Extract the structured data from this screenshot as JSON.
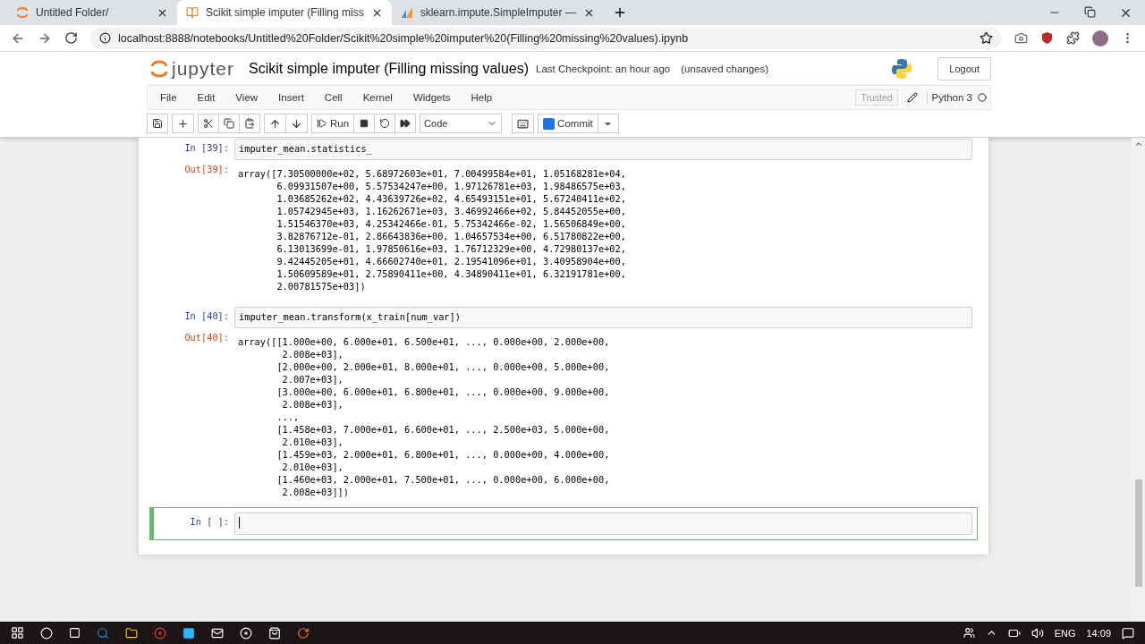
{
  "browser": {
    "tabs": [
      {
        "title": "Untitled Folder/",
        "selected": false
      },
      {
        "title": "Scikit simple imputer (Filling miss",
        "selected": true
      },
      {
        "title": "sklearn.impute.SimpleImputer —",
        "selected": false
      }
    ],
    "address": "localhost:8888/notebooks/Untitled%20Folder/Scikit%20simple%20imputer%20(Filling%20missing%20values).ipynb"
  },
  "header": {
    "logo_text": "jupyter",
    "title": "Scikit simple imputer (Filling missing values)",
    "checkpoint": "Last Checkpoint: an hour ago",
    "status": "(unsaved changes)",
    "logout": "Logout"
  },
  "menu": [
    "File",
    "Edit",
    "View",
    "Insert",
    "Cell",
    "Kernel",
    "Widgets",
    "Help"
  ],
  "trusted": "Trusted",
  "kernel": "Python 3",
  "toolbar": {
    "run": "Run",
    "cell_type": "Code",
    "commit": "Commit"
  },
  "cells": [
    {
      "prompt": "In [39]:",
      "code": "imputer_mean.statistics_",
      "out_prompt": "Out[39]:",
      "output": "array([7.30500000e+02, 5.68972603e+01, 7.00499584e+01, 1.05168281e+04,\n       6.09931507e+00, 5.57534247e+00, 1.97126781e+03, 1.98486575e+03,\n       1.03685262e+02, 4.43639726e+02, 4.65493151e+01, 5.67240411e+02,\n       1.05742945e+03, 1.16262671e+03, 3.46992466e+02, 5.84452055e+00,\n       1.51546370e+03, 4.25342466e-01, 5.75342466e-02, 1.56506849e+00,\n       3.82876712e-01, 2.86643836e+00, 1.04657534e+00, 6.51780822e+00,\n       6.13013699e-01, 1.97850616e+03, 1.76712329e+00, 4.72980137e+02,\n       9.42445205e+01, 4.66602740e+01, 2.19541096e+01, 3.40958904e+00,\n       1.50609589e+01, 2.75890411e+00, 4.34890411e+01, 6.32191781e+00,\n       2.00781575e+03])",
      "selected": false
    },
    {
      "prompt": "In [40]:",
      "code": "imputer_mean.transform(x_train[num_var])",
      "out_prompt": "Out[40]:",
      "output": "array([[1.000e+00, 6.000e+01, 6.500e+01, ..., 0.000e+00, 2.000e+00,\n        2.008e+03],\n       [2.000e+00, 2.000e+01, 8.000e+01, ..., 0.000e+00, 5.000e+00,\n        2.007e+03],\n       [3.000e+00, 6.000e+01, 6.800e+01, ..., 0.000e+00, 9.000e+00,\n        2.008e+03],\n       ...,\n       [1.458e+03, 7.000e+01, 6.600e+01, ..., 2.500e+03, 5.000e+00,\n        2.010e+03],\n       [1.459e+03, 2.000e+01, 6.800e+01, ..., 0.000e+00, 4.000e+00,\n        2.010e+03],\n       [1.460e+03, 2.000e+01, 7.500e+01, ..., 0.000e+00, 6.000e+00,\n        2.008e+03]])",
      "selected": false
    },
    {
      "prompt": "In [ ]:",
      "selected": true
    }
  ],
  "taskbar": {
    "language": "ENG",
    "time": "14:09"
  }
}
